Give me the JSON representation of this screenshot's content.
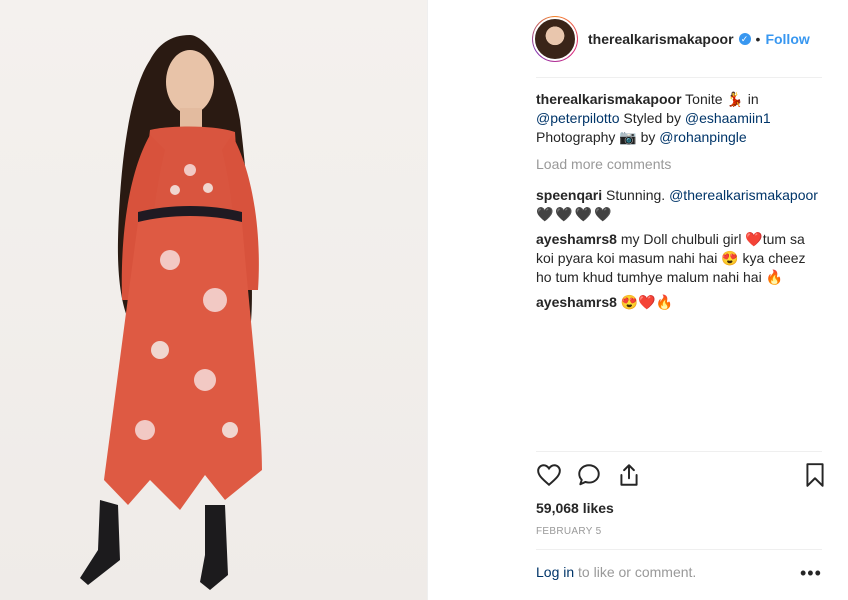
{
  "post": {
    "username": "therealkarismakapoor",
    "verified_mark": "✓",
    "separator": "•",
    "follow_label": "Follow"
  },
  "caption": {
    "username": "therealkarismakapoor",
    "text_1": "Tonite 💃 in",
    "mention_1": "@peterpilotto",
    "text_2": " Styled by ",
    "mention_2": "@eshaamiin1",
    "text_3": "Photography 📷 by ",
    "mention_3": "@rohanpingle"
  },
  "load_more": "Load more comments",
  "comments": [
    {
      "username": "speenqari",
      "text": "Stunning.",
      "mention": "@therealkarismakapoor",
      "extra": "🖤🖤🖤🖤"
    },
    {
      "username": "ayeshamrs8",
      "text": "my Doll chulbuli girl ❤️tum sa koi pyara koi masum nahi hai 😍 kya cheez ho tum khud tumhye malum nahi hai 🔥"
    },
    {
      "username": "ayeshamrs8",
      "text": "😍❤️🔥"
    }
  ],
  "likes": "59,068 likes",
  "date": "FEBRUARY 5",
  "footer": {
    "login_label": "Log in",
    "rest": " to like or comment."
  },
  "more_label": "•••",
  "icons": [
    "heart-icon",
    "comment-icon",
    "share-icon",
    "bookmark-icon",
    "more-icon"
  ]
}
